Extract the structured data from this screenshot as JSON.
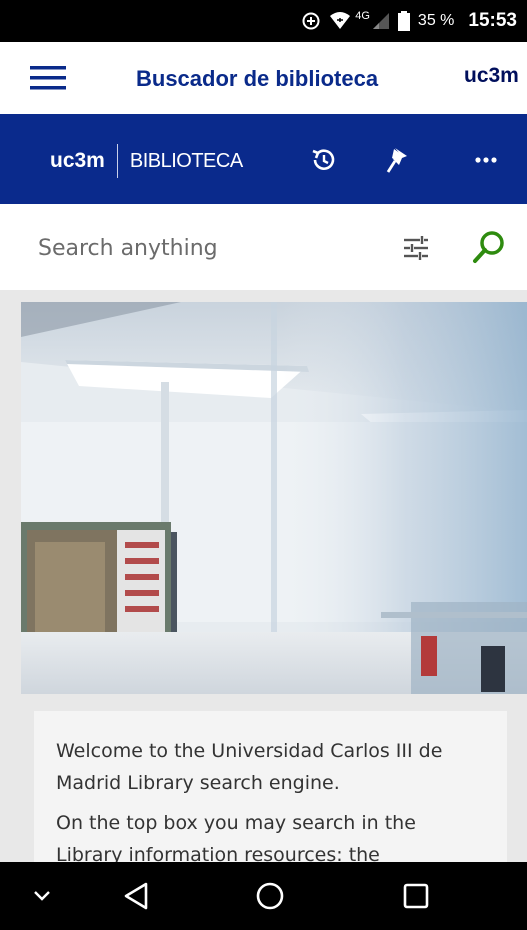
{
  "status_bar": {
    "network": "4G",
    "battery_percent": "35 %",
    "time": "15:53"
  },
  "app_bar": {
    "title": "Buscador de biblioteca",
    "logo": "uc3m"
  },
  "header": {
    "brand_short": "uc3m",
    "brand_name": "BIBLIOTECA",
    "icons": [
      "history-icon",
      "pin-icon",
      "more-icon"
    ]
  },
  "search": {
    "placeholder": "Search anything"
  },
  "welcome": {
    "paragraph_1": "Welcome to the Universidad Carlos III de Madrid Library search engine.",
    "paragraph_2": "On the top box you may search in the Library information resources: the"
  },
  "colors": {
    "brand_blue": "#0a2a8c",
    "title_blue": "#0a2a8a",
    "search_green": "#2e8b0f"
  }
}
